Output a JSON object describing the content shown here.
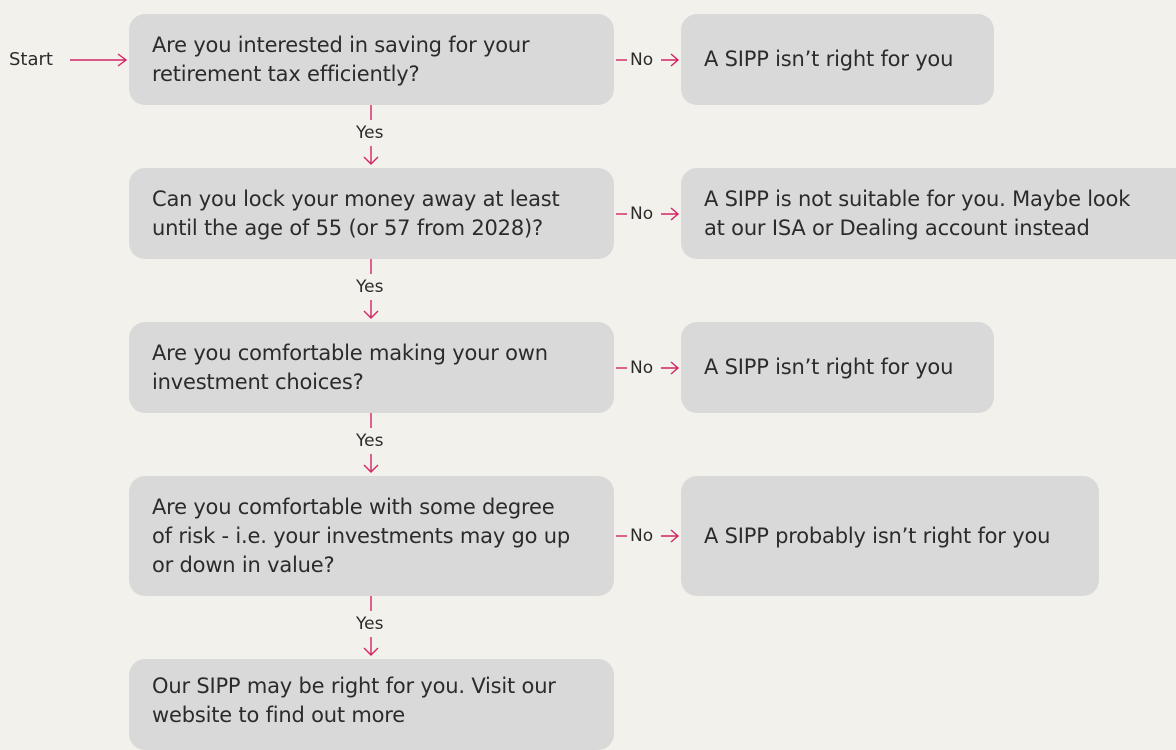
{
  "start": "Start",
  "yes_label": "Yes",
  "no_label": "No",
  "questions": [
    "Are you interested in saving for your\nretirement tax efficiently?",
    "Can you lock your money away at least\nuntil the age of 55 (or 57 from 2028)?",
    "Are you comfortable making your own\ninvestment choices?",
    "Are you comfortable with some degree\nof risk - i.e. your investments may go up\nor down in value?"
  ],
  "outcomes": [
    "A SIPP isn’t right for you",
    "A SIPP is not suitable for you. Maybe look\nat our ISA or Dealing account instead",
    "A SIPP isn’t right for you",
    "A SIPP probably isn’t right for you"
  ],
  "final": "Our SIPP may be right for you. Visit our\nwebsite to find out more",
  "colors": {
    "background": "#f2f1eb",
    "box": "#d9d9d9",
    "connector": "#d32464",
    "text": "#2b2b2b"
  }
}
